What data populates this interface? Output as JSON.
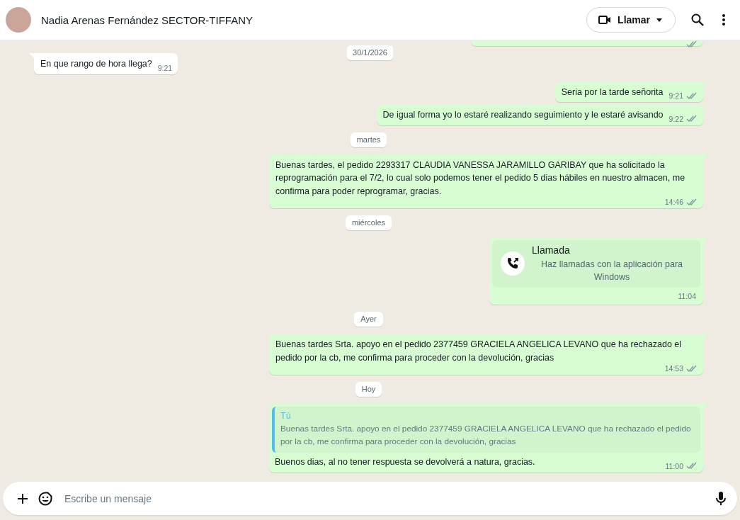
{
  "header": {
    "contact_name": "Nadia Arenas Fernández SECTOR-TIFFANY",
    "call_button": "Llamar"
  },
  "sticky_date": "30/1/2026",
  "messages": [
    {
      "kind": "cut",
      "outgoing": true,
      "read": false
    },
    {
      "kind": "text",
      "outgoing": false,
      "text": "En que rango de hora llega?",
      "time": "9:21"
    },
    {
      "kind": "text",
      "outgoing": true,
      "text": "Seria por la tarde señorita",
      "time": "9:21",
      "read": false
    },
    {
      "kind": "text",
      "outgoing": true,
      "text": "De igual forma yo lo estaré realizando seguimiento y le estaré avisando",
      "time": "9:22",
      "read": false
    },
    {
      "kind": "date",
      "text": "martes"
    },
    {
      "kind": "text",
      "outgoing": true,
      "text": "Buenas tardes, el pedido 2293317 CLAUDIA VANESSA JARAMILLO GARIBAY que ha solicitado la reprogramación para el 7/2, lo cual solo podemos tener el pedido 5 dias hábiles en nuestro almacen, me confirma para poder reprogramar, gracias.",
      "time": "14:46",
      "read": false
    },
    {
      "kind": "date",
      "text": "miércoles"
    },
    {
      "kind": "call",
      "outgoing": true,
      "title": "Llamada",
      "subtitle": "Haz llamadas con la aplicación para Windows",
      "time": "11:04"
    },
    {
      "kind": "date",
      "text": "Ayer"
    },
    {
      "kind": "text",
      "outgoing": true,
      "text": "Buenas tardes Srta. apoyo en el pedido 2377459 GRACIELA ANGELICA LEVANO que ha rechazado el pedido por la cb, me confirma para proceder con la devolución, gracias",
      "time": "14:53",
      "read": false
    },
    {
      "kind": "date",
      "text": "Hoy"
    },
    {
      "kind": "reply",
      "outgoing": true,
      "quote_author": "Tú",
      "quote_text": "Buenas tardes Srta. apoyo en el pedido 2377459 GRACIELA ANGELICA LEVANO que ha rechazado el pedido por la cb, me confirma para proceder con la devolución, gracias",
      "text": "Buenos dias, al no tener respuesta se devolverá a natura, gracias.",
      "time": "11:00",
      "read": false
    }
  ],
  "composer": {
    "placeholder": "Escribe un mensaje"
  }
}
